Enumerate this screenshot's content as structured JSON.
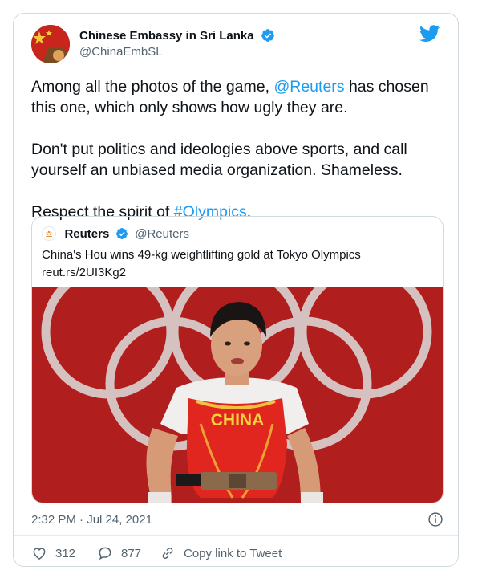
{
  "author": {
    "display_name": "Chinese Embassy in Sri Lanka",
    "handle": "@ChinaEmbSL",
    "verified": true
  },
  "tweet": {
    "line1_prefix": "Among all the photos of the game, ",
    "line1_mention": "@Reuters",
    "line1_suffix": " has chosen this one, which only shows how ugly they are.",
    "para2": "Don't put politics and ideologies above sports, and call yourself an unbiased media organization. Shameless.",
    "para3_prefix": "Respect the spirit of ",
    "para3_hashtag": "#Olympics",
    "para3_suffix": "."
  },
  "quoted": {
    "name": "Reuters",
    "handle": "@Reuters",
    "title": "China's Hou wins 49-kg weightlifting gold at Tokyo Olympics",
    "link": "reut.rs/2UI3Kg2",
    "image_jersey_text": "CHINA"
  },
  "timestamp": "2:32 PM · Jul 24, 2021",
  "actions": {
    "like_count": "312",
    "reply_count": "877",
    "copy_link_label": "Copy link to Tweet"
  },
  "colors": {
    "accent": "#1d9bf0",
    "muted": "#536471",
    "image_bg": "#b11e1e"
  },
  "icons": [
    "twitter-bird-icon",
    "verified-badge-icon",
    "info-icon",
    "heart-icon",
    "reply-icon",
    "link-icon"
  ]
}
